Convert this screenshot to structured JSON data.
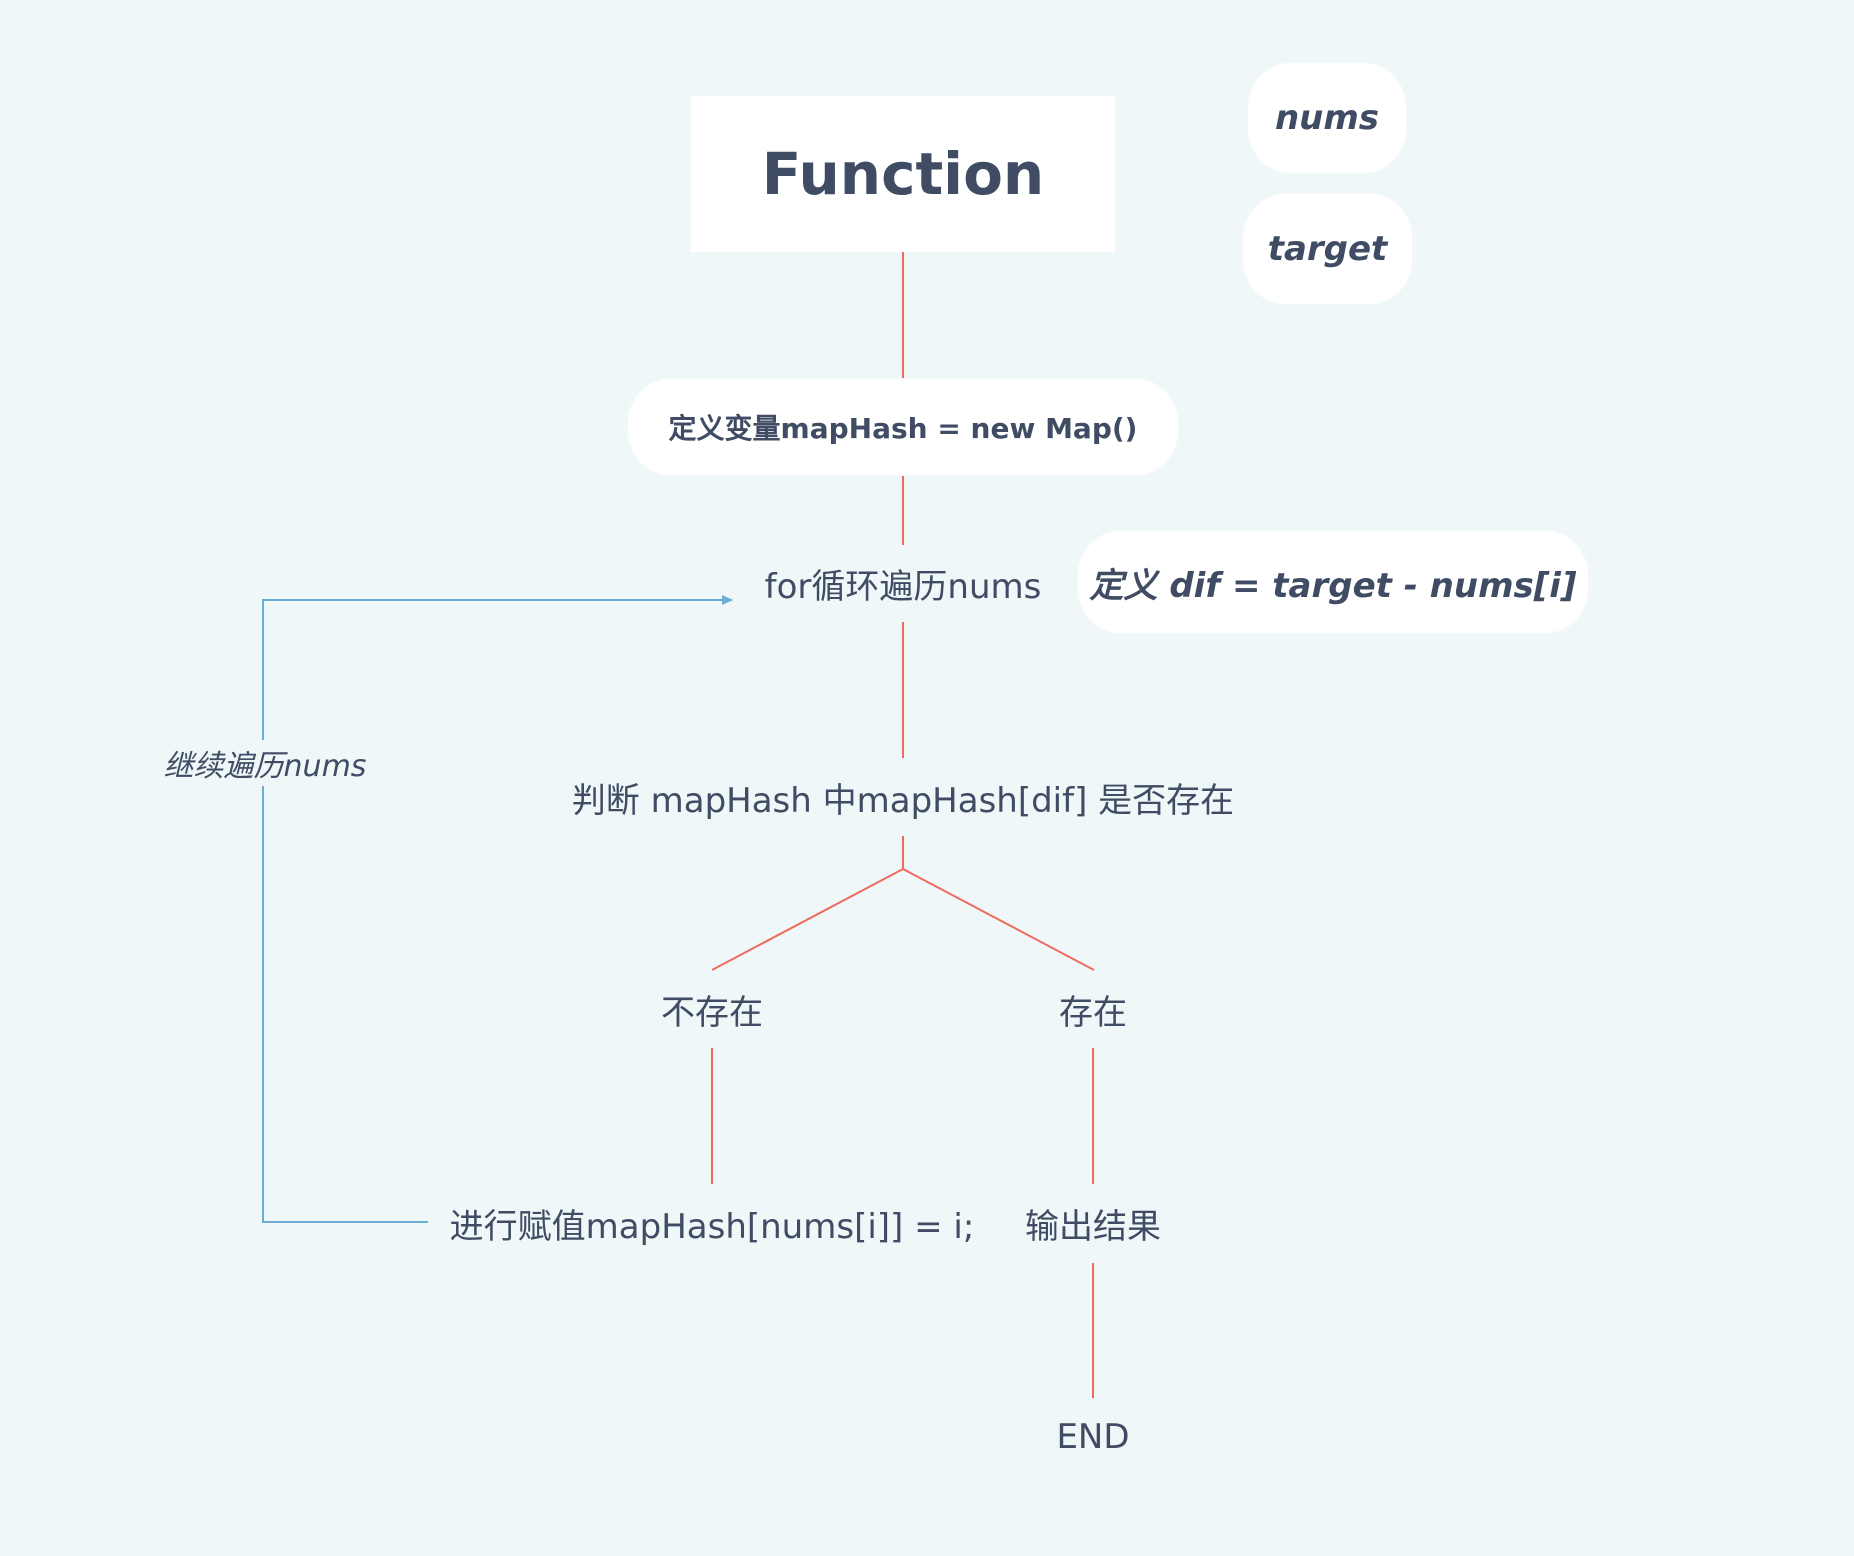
{
  "diagram": {
    "title": "Function",
    "params": {
      "nums": "nums",
      "target": "target"
    },
    "steps": {
      "define_map": "定义变量mapHash = new Map()",
      "for_loop": "for循环遍历nums",
      "define_dif": "定义 dif = target - nums[i]",
      "check": "判断 mapHash 中mapHash[dif] 是否存在",
      "not_exist": "不存在",
      "exist": "存在",
      "assign": "进行赋值mapHash[nums[i]] = i;",
      "output": "输出结果",
      "end": "END"
    },
    "loop_label": "继续遍历nums"
  },
  "colors": {
    "background": "#eff7f8",
    "text": "#3f4c63",
    "box_fill": "#ffffff",
    "flow_line": "#ee6b5e",
    "loop_line": "#6aaed6"
  }
}
